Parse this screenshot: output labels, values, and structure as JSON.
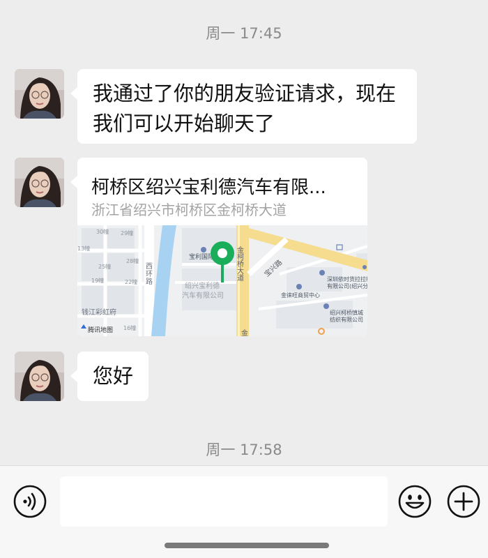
{
  "timestamps": [
    "周一 17:45",
    "周一 17:58"
  ],
  "messages": {
    "greeting": [
      "我通过了你的朋友验证请求，现在",
      "我们可以开始聊天了"
    ],
    "location": {
      "title": "柯桥区绍兴宝利德汽车有限...",
      "address": "浙江省绍兴市柯桥区金柯桥大道",
      "map": {
        "road_label": "金柯桥大道",
        "poi_main": [
          "绍兴宝利德",
          "汽车有限公司"
        ],
        "poi_top": "宝利国际",
        "poi_right1": [
          "深圳依时货拉拉科技",
          "有限公司(绍兴分..."
        ],
        "poi_right2": "金徕旺商贸中心",
        "poi_right3": [
          "绍兴柯桥慎城",
          "纺织有限公司"
        ],
        "west_road": [
          "西",
          "环",
          "路"
        ],
        "market": "钱江彩虹府",
        "building_labels": [
          "30幢",
          "29幢",
          "13幢",
          "28幢",
          "25幢",
          "19幢",
          "22幢",
          "16幢"
        ],
        "diag_road": "宝兴路",
        "bottom_char": "金",
        "brand": "腾讯地图"
      }
    },
    "hello": "您好"
  },
  "colors": {
    "background": "#ededed",
    "bubble": "#ffffff",
    "pin": "#1aad5a",
    "road_yellow": "#f6dc8f",
    "river": "#a7d2f2"
  },
  "icons": {
    "voice": "voice-icon",
    "emoji": "emoji-icon",
    "plus": "plus-icon"
  },
  "input": {
    "value": ""
  }
}
